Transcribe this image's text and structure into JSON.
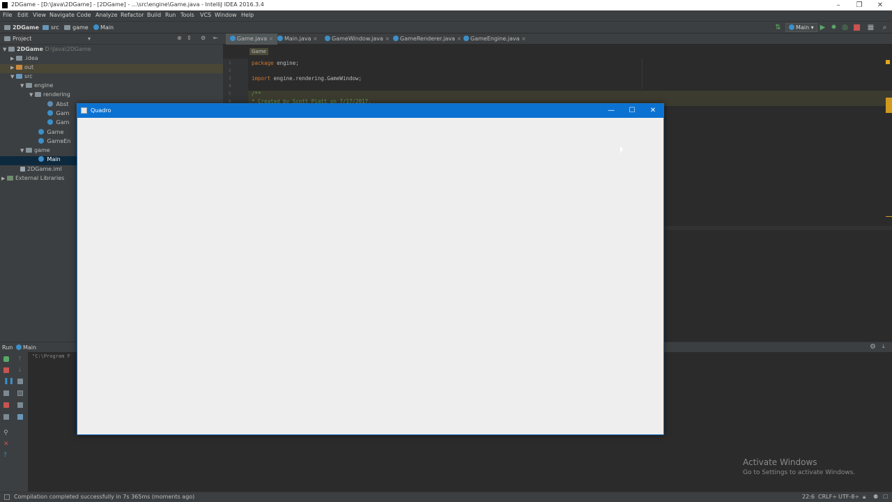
{
  "window": {
    "title": "2DGame - [D:\\Java\\2DGame] - [2DGame] - ...\\src\\engine\\Game.java - IntelliJ IDEA 2016.3.4",
    "minimize": "–",
    "restore": "❐",
    "close": "✕"
  },
  "menu": [
    "File",
    "Edit",
    "View",
    "Navigate",
    "Code",
    "Analyze",
    "Refactor",
    "Build",
    "Run",
    "Tools",
    "VCS",
    "Window",
    "Help"
  ],
  "navbar": {
    "crumbs": [
      "2DGame",
      "src",
      "game",
      "Main"
    ],
    "run_config": "Main"
  },
  "project": {
    "header": "Project",
    "tree": [
      {
        "label": "2DGame",
        "extra": "D:\\Java\\2DGame",
        "level": 0,
        "arrow": "▼",
        "icon": "folder"
      },
      {
        "label": ".idea",
        "level": 1,
        "arrow": "▶",
        "icon": "folder"
      },
      {
        "label": "out",
        "level": 1,
        "arrow": "▶",
        "icon": "folder-orange"
      },
      {
        "label": "src",
        "level": 1,
        "arrow": "▼",
        "icon": "folder-blue"
      },
      {
        "label": "engine",
        "level": 2,
        "arrow": "▼",
        "icon": "folder"
      },
      {
        "label": "rendering",
        "level": 3,
        "arrow": "▼",
        "icon": "folder"
      },
      {
        "label": "Abst",
        "level": 4,
        "arrow": "",
        "icon": "class"
      },
      {
        "label": "Gam",
        "level": 4,
        "arrow": "",
        "icon": "class"
      },
      {
        "label": "Gam",
        "level": 4,
        "arrow": "",
        "icon": "class"
      },
      {
        "label": "Game",
        "level": 3,
        "arrow": "",
        "icon": "class"
      },
      {
        "label": "GameEn",
        "level": 3,
        "arrow": "",
        "icon": "class"
      },
      {
        "label": "game",
        "level": 2,
        "arrow": "▼",
        "icon": "folder"
      },
      {
        "label": "Main",
        "level": 3,
        "arrow": "",
        "icon": "class",
        "selected": true
      },
      {
        "label": "2DGame.iml",
        "level": 1,
        "arrow": "",
        "icon": "file"
      },
      {
        "label": "External Libraries",
        "level": 0,
        "arrow": "▶",
        "icon": "lib"
      }
    ]
  },
  "tabs": [
    "Game.java",
    "Main.java",
    "GameWindow.java",
    "GameRenderer.java",
    "GameEngine.java"
  ],
  "editor": {
    "breadcrumb": "Game",
    "lines": [
      {
        "n": "1",
        "kw": "package",
        "text": " engine;"
      },
      {
        "n": "2",
        "kw": "",
        "text": ""
      },
      {
        "n": "3",
        "kw": "import",
        "text": " engine.rendering.GameWindow;"
      },
      {
        "n": "4",
        "kw": "",
        "text": ""
      },
      {
        "n": "5",
        "comment": "/**"
      },
      {
        "n": "6",
        "comment": " * Created by Scott Piatt on 7/17/2017."
      }
    ]
  },
  "run": {
    "label": "Run",
    "config": "Main",
    "console": "\"C:\\Program F"
  },
  "status": {
    "message": "Compilation completed successfully in 7s 365ms (moments ago)",
    "position": "22:6",
    "line_sep": "CRLF÷",
    "encoding": "UTF-8÷"
  },
  "quadro": {
    "title": "Quadro",
    "minimize": "—",
    "maximize": "☐",
    "close": "✕"
  },
  "activate": {
    "title": "Activate Windows",
    "subtitle": "Go to Settings to activate Windows."
  }
}
